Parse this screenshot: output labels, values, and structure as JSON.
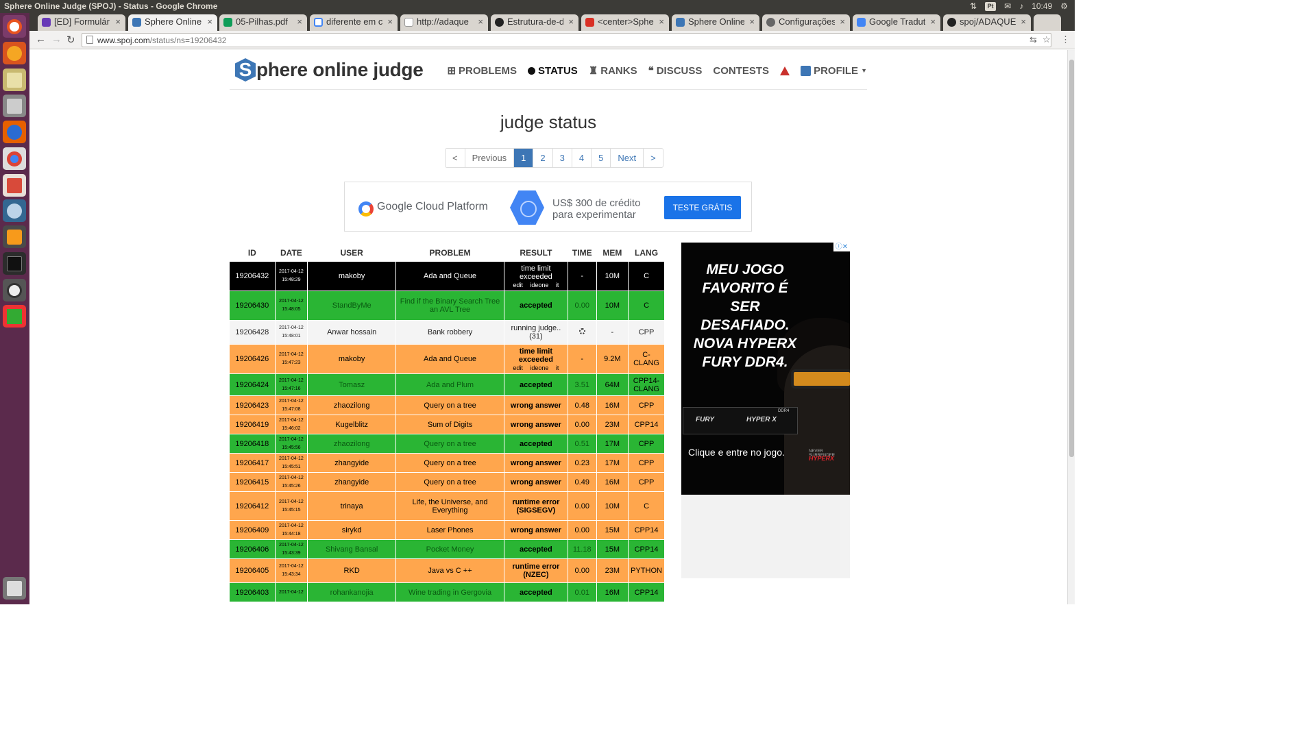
{
  "os": {
    "window_title": "Sphere Online Judge (SPOJ) - Status - Google Chrome",
    "lang_indicator": "Pt",
    "clock": "10:49"
  },
  "browser": {
    "tabs": [
      {
        "label": "[ED] Formulár",
        "favicon_color": "#673ab7"
      },
      {
        "label": "Sphere Online",
        "favicon_color": "#3d76b5",
        "active": true
      },
      {
        "label": "05-Pilhas.pdf",
        "favicon_color": "#0f9d58"
      },
      {
        "label": "diferente em c",
        "favicon_color": "#ffffff"
      },
      {
        "label": "http://adaque",
        "favicon_color": "#bbbbbb"
      },
      {
        "label": "Estrutura-de-d",
        "favicon_color": "#222222"
      },
      {
        "label": "<center>Spher",
        "favicon_color": "#d93025"
      },
      {
        "label": "Sphere Online",
        "favicon_color": "#3d76b5"
      },
      {
        "label": "Configurações",
        "favicon_color": "#666666"
      },
      {
        "label": "Google Tradut",
        "favicon_color": "#4285f4"
      },
      {
        "label": "spoj/ADAQUE",
        "favicon_color": "#222222"
      }
    ],
    "url_host": "www.spoj.com",
    "url_path": "/status/ns=19206432"
  },
  "site": {
    "logo_mark": "S",
    "logo_text": "phere online judge",
    "nav": [
      {
        "label": "PROBLEMS",
        "icon": "sitemap-icon"
      },
      {
        "label": "STATUS",
        "icon": "circle-icon",
        "current": true
      },
      {
        "label": "RANKS",
        "icon": "trophy-icon"
      },
      {
        "label": "DISCUSS",
        "icon": "comments-icon"
      },
      {
        "label": "CONTESTS",
        "icon": ""
      }
    ],
    "profile_label": "PROFILE"
  },
  "page": {
    "title": "judge status"
  },
  "pagination": {
    "first": "<",
    "previous": "Previous",
    "pages": [
      "1",
      "2",
      "3",
      "4",
      "5"
    ],
    "next": "Next",
    "last": ">",
    "current": "1"
  },
  "ad_top": {
    "brand": "Google Cloud Platform",
    "offer_line1": "US$ 300 de crédito",
    "offer_line2": "para experimentar",
    "button": "TESTE GRÁTIS"
  },
  "table": {
    "headers": [
      "ID",
      "DATE",
      "USER",
      "PROBLEM",
      "RESULT",
      "TIME",
      "MEM",
      "LANG"
    ],
    "rows": [
      {
        "id": "19206432",
        "date": "2017-04-12",
        "time_of_day": "15:48:29",
        "user": "makoby",
        "problem": "Ada and Queue",
        "result": "time limit exceeded",
        "result_links": "edit ideone it",
        "time": "-",
        "mem": "10M",
        "lang": "C",
        "color": "black"
      },
      {
        "id": "19206430",
        "date": "2017-04-12",
        "time_of_day": "15:48:05",
        "user": "StandByMe",
        "problem": "Find if the Binary Search Tree an AVL Tree",
        "result": "accepted",
        "result_links": "",
        "time": "0.00",
        "mem": "10M",
        "lang": "C",
        "color": "green"
      },
      {
        "id": "19206428",
        "date": "2017-04-12",
        "time_of_day": "15:48:01",
        "user": "Anwar hossain",
        "problem": "Bank robbery",
        "result": "running judge.. (31)",
        "result_links": "",
        "time": "spinner",
        "mem": "-",
        "lang": "CPP",
        "color": "gray"
      },
      {
        "id": "19206426",
        "date": "2017-04-12",
        "time_of_day": "15:47:23",
        "user": "makoby",
        "problem": "Ada and Queue",
        "result": "time limit exceeded",
        "result_links": "edit ideone it",
        "time": "-",
        "mem": "9.2M",
        "lang": "C-CLANG",
        "color": "orange"
      },
      {
        "id": "19206424",
        "date": "2017-04-12",
        "time_of_day": "15:47:16",
        "user": "Tomasz",
        "problem": "Ada and Plum",
        "result": "accepted",
        "result_links": "",
        "time": "3.51",
        "mem": "64M",
        "lang": "CPP14-CLANG",
        "color": "green"
      },
      {
        "id": "19206423",
        "date": "2017-04-12",
        "time_of_day": "15:47:08",
        "user": "zhaozilong",
        "problem": "Query on a tree",
        "result": "wrong answer",
        "result_links": "",
        "time": "0.48",
        "mem": "16M",
        "lang": "CPP",
        "color": "orange"
      },
      {
        "id": "19206419",
        "date": "2017-04-12",
        "time_of_day": "15:46:02",
        "user": "Kugelblitz",
        "problem": "Sum of Digits",
        "result": "wrong answer",
        "result_links": "",
        "time": "0.00",
        "mem": "23M",
        "lang": "CPP14",
        "color": "orange"
      },
      {
        "id": "19206418",
        "date": "2017-04-12",
        "time_of_day": "15:45:56",
        "user": "zhaozilong",
        "problem": "Query on a tree",
        "result": "accepted",
        "result_links": "",
        "time": "0.51",
        "mem": "17M",
        "lang": "CPP",
        "color": "green"
      },
      {
        "id": "19206417",
        "date": "2017-04-12",
        "time_of_day": "15:45:51",
        "user": "zhangyide",
        "problem": "Query on a tree",
        "result": "wrong answer",
        "result_links": "",
        "time": "0.23",
        "mem": "17M",
        "lang": "CPP",
        "color": "orange"
      },
      {
        "id": "19206415",
        "date": "2017-04-12",
        "time_of_day": "15:45:26",
        "user": "zhangyide",
        "problem": "Query on a tree",
        "result": "wrong answer",
        "result_links": "",
        "time": "0.49",
        "mem": "16M",
        "lang": "CPP",
        "color": "orange"
      },
      {
        "id": "19206412",
        "date": "2017-04-12",
        "time_of_day": "15:45:15",
        "user": "trinaya",
        "problem": "Life, the Universe, and Everything",
        "result": "runtime error (SIGSEGV)",
        "result_links": "",
        "time": "0.00",
        "mem": "10M",
        "lang": "C",
        "color": "orange"
      },
      {
        "id": "19206409",
        "date": "2017-04-12",
        "time_of_day": "15:44:18",
        "user": "sirykd",
        "problem": "Laser Phones",
        "result": "wrong answer",
        "result_links": "",
        "time": "0.00",
        "mem": "15M",
        "lang": "CPP14",
        "color": "orange"
      },
      {
        "id": "19206406",
        "date": "2017-04-12",
        "time_of_day": "15:43:39",
        "user": "Shivang Bansal",
        "problem": "Pocket Money",
        "result": "accepted",
        "result_links": "",
        "time": "11.18",
        "mem": "15M",
        "lang": "CPP14",
        "color": "green"
      },
      {
        "id": "19206405",
        "date": "2017-04-12",
        "time_of_day": "15:43:34",
        "user": "RKD",
        "problem": "Java vs C ++",
        "result": "runtime error (NZEC)",
        "result_links": "",
        "time": "0.00",
        "mem": "23M",
        "lang": "PYTHON",
        "color": "orange"
      },
      {
        "id": "19206403",
        "date": "2017-04-12",
        "time_of_day": "",
        "user": "rohankanojia",
        "problem": "Wine trading in Gergovia",
        "result": "accepted",
        "result_links": "",
        "time": "0.01",
        "mem": "16M",
        "lang": "CPP14",
        "color": "green"
      }
    ]
  },
  "ad_right": {
    "headline": "MEU JOGO FAVORITO É SER DESAFIADO. NOVA HYPERX FURY DDR4.",
    "ram_brand": "FURY",
    "ram_brand2": "HYPER X",
    "ram_tag": "DDR4",
    "cta": "Clique e entre no jogo.",
    "tagline": "NEVER SURRENDER",
    "tagline_brand": "HYPERX"
  },
  "colors": {
    "accepted": "#2ab534",
    "failed": "#ffa64d",
    "highlight": "#000000",
    "pending": "#f4f4f4",
    "brand_blue": "#3d76b5"
  }
}
